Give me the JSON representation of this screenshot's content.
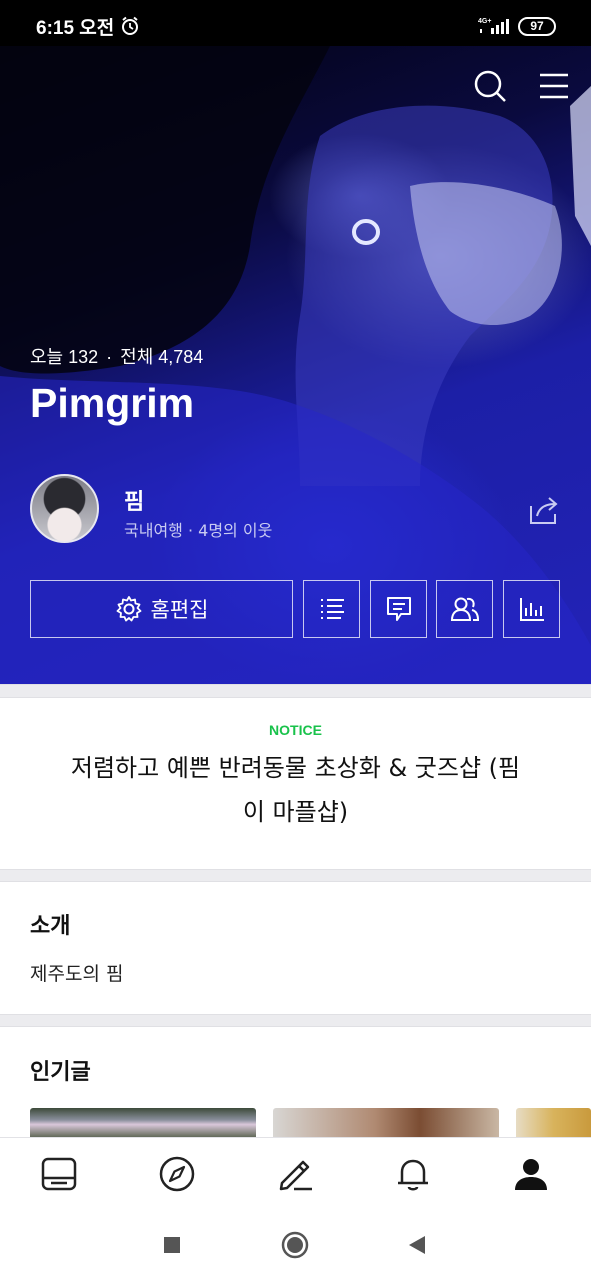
{
  "status_bar": {
    "time": "6:15 오전",
    "battery": "97",
    "network": "4G+",
    "icons": [
      "alarm-icon",
      "signal-icon",
      "battery-icon"
    ]
  },
  "hero": {
    "icons": [
      "search-icon",
      "menu-icon"
    ],
    "stats": {
      "today_label": "오늘 132",
      "total_label": "전체 4,784",
      "separator": "·"
    },
    "title": "Pimgrim",
    "profile": {
      "nickname": "핌",
      "meta": "국내여행 · 4명의 이웃"
    },
    "buttons": {
      "edit_label": "홈편집",
      "icons": [
        "list-icon",
        "comment-icon",
        "neighbors-icon",
        "stats-icon"
      ]
    }
  },
  "notice": {
    "label": "NOTICE",
    "text_line1": "저렴하고 예쁜 반려동물 초상화 & 굿즈샵 (핌",
    "text_line2": "이 마플샵)"
  },
  "intro": {
    "title": "소개",
    "body": "제주도의 핌"
  },
  "popular": {
    "title": "인기글"
  },
  "bottom_nav": {
    "items": [
      "feed-icon",
      "discover-icon",
      "write-icon",
      "notification-icon",
      "profile-icon"
    ],
    "active": "profile-icon"
  },
  "system_nav": {
    "items": [
      "recents-icon",
      "home-icon",
      "back-icon"
    ]
  },
  "colors": {
    "notice_accent": "#19c24b",
    "hero_blue": "#2323b8"
  }
}
